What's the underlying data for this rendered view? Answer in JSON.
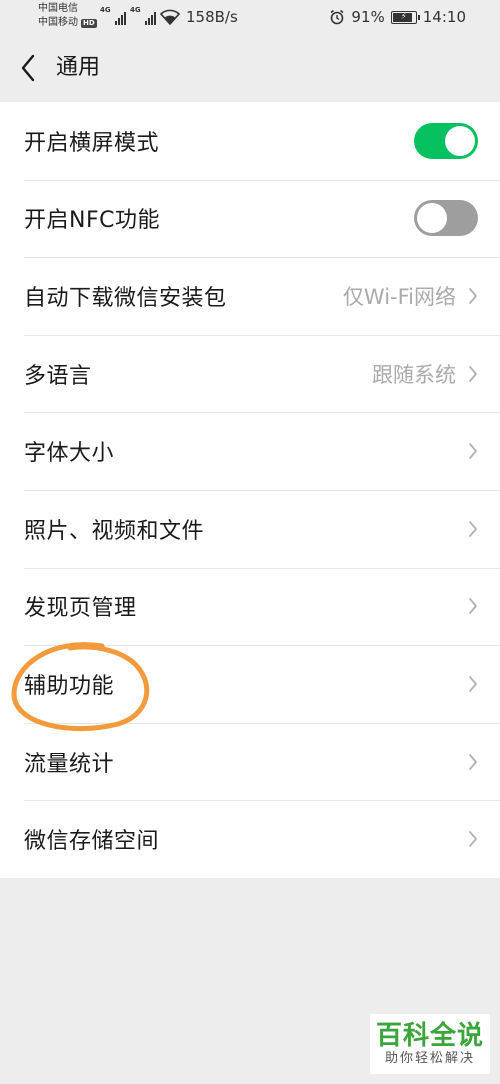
{
  "status_bar": {
    "carrier_1": "中国电信",
    "carrier_2": "中国移动",
    "hd_badge": "HD",
    "net_type_1": "4G",
    "net_type_2": "4G",
    "speed": "158B/s",
    "battery_percent": "91%",
    "battery_level": 0.91,
    "time": "14:10"
  },
  "nav": {
    "title": "通用"
  },
  "settings": {
    "items": [
      {
        "label": "开启横屏模式",
        "kind": "toggle",
        "on": true
      },
      {
        "label": "开启NFC功能",
        "kind": "toggle",
        "on": false
      },
      {
        "label": "自动下载微信安装包",
        "kind": "value",
        "value": "仅Wi-Fi网络"
      },
      {
        "label": "多语言",
        "kind": "value",
        "value": "跟随系统"
      },
      {
        "label": "字体大小",
        "kind": "link"
      },
      {
        "label": "照片、视频和文件",
        "kind": "link"
      },
      {
        "label": "发现页管理",
        "kind": "link"
      },
      {
        "label": "辅助功能",
        "kind": "link"
      },
      {
        "label": "流量统计",
        "kind": "link"
      },
      {
        "label": "微信存储空间",
        "kind": "link"
      }
    ]
  },
  "colors": {
    "toggle_on": "#07c160",
    "toggle_off": "#9e9e9e",
    "highlight_ring": "#f39a3c",
    "watermark_green": "#3aa53a"
  },
  "watermark": {
    "main": "百科全说",
    "sub": "助你轻松解决"
  }
}
